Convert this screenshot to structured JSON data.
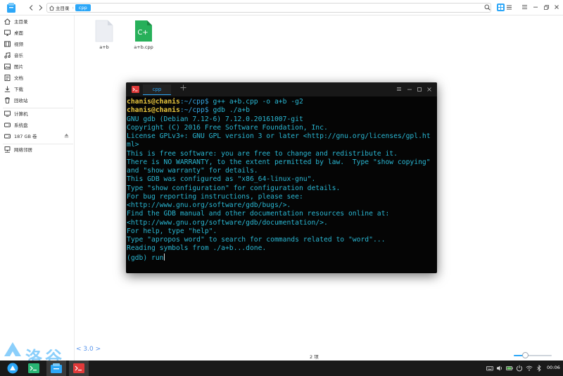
{
  "file_manager": {
    "breadcrumb": {
      "home": "主目录",
      "current": "cpp"
    },
    "sidebar": [
      {
        "label": "主目录",
        "icon": "home-icon"
      },
      {
        "label": "桌面",
        "icon": "desktop-icon"
      },
      {
        "label": "视频",
        "icon": "video-icon"
      },
      {
        "label": "音乐",
        "icon": "music-icon"
      },
      {
        "label": "图片",
        "icon": "picture-icon"
      },
      {
        "label": "文档",
        "icon": "document-icon"
      },
      {
        "label": "下载",
        "icon": "download-icon"
      },
      {
        "label": "回收站",
        "icon": "trash-icon"
      },
      {
        "label": "计算机",
        "icon": "computer-icon"
      },
      {
        "label": "系统盘",
        "icon": "system-disk-icon"
      },
      {
        "label": "187 GB 卷",
        "icon": "disk-icon"
      },
      {
        "label": "网络邻居",
        "icon": "network-icon"
      }
    ],
    "files": [
      {
        "name": "a+b",
        "icon": "executable-file-icon"
      },
      {
        "name": "a+b.cpp",
        "icon": "cpp-file-icon",
        "badge": "C+"
      }
    ],
    "status": "2 项",
    "zoom_level": 0.3,
    "colors": {
      "accent": "#2ca7f8",
      "cpp_icon": "#27b05a"
    }
  },
  "terminal": {
    "tab": "cpp",
    "lines": [
      {
        "user": "chanis@chanis",
        "path": ":~/cpp$",
        "cmd": " g++ a+b.cpp -o a+b -g2"
      },
      {
        "user": "chanis@chanis",
        "path": ":~/cpp$",
        "cmd": " gdb ./a+b"
      },
      {
        "text": "GNU gdb (Debian 7.12-6) 7.12.0.20161007-git"
      },
      {
        "text": "Copyright (C) 2016 Free Software Foundation, Inc."
      },
      {
        "text": "License GPLv3+: GNU GPL version 3 or later <http://gnu.org/licenses/gpl.ht"
      },
      {
        "text": "ml>"
      },
      {
        "text": "This is free software: you are free to change and redistribute it."
      },
      {
        "text": "There is NO WARRANTY, to the extent permitted by law.  Type \"show copying\""
      },
      {
        "text": "and \"show warranty\" for details."
      },
      {
        "text": "This GDB was configured as \"x86_64-linux-gnu\"."
      },
      {
        "text": "Type \"show configuration\" for configuration details."
      },
      {
        "text": "For bug reporting instructions, please see:"
      },
      {
        "text": "<http://www.gnu.org/software/gdb/bugs/>."
      },
      {
        "text": "Find the GDB manual and other documentation resources online at:"
      },
      {
        "text": "<http://www.gnu.org/software/gdb/documentation/>."
      },
      {
        "text": "For help, type \"help\"."
      },
      {
        "text": "Type \"apropos word\" to search for commands related to \"word\"..."
      },
      {
        "text": "Reading symbols from ./a+b...done."
      },
      {
        "text": "(gdb) run"
      }
    ],
    "colors": {
      "output": "#2ab8d4",
      "user": "#e8c53e",
      "path": "#36a7e6"
    }
  },
  "watermark": {
    "text": "洛谷",
    "version": "< 3.0 >"
  },
  "taskbar": {
    "clock": "00:06",
    "items": [
      "launcher-icon",
      "terminal-app-icon",
      "file-manager-app-icon",
      "deepin-terminal-app-icon"
    ]
  }
}
